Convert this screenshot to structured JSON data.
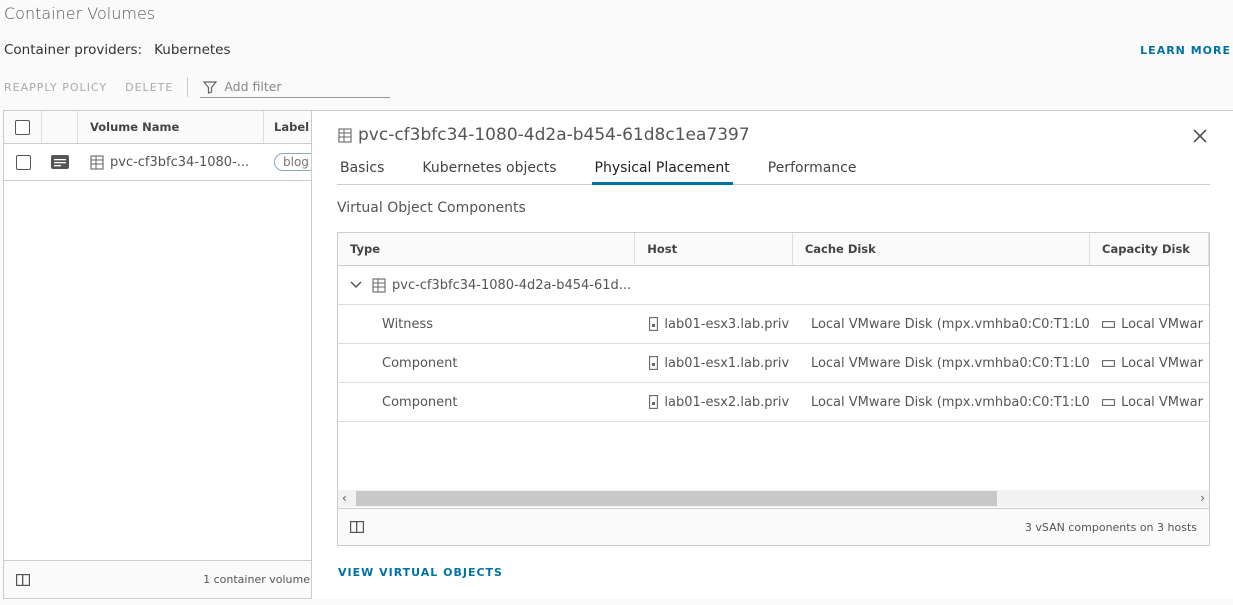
{
  "page": {
    "title": "Container Volumes"
  },
  "providers": {
    "label": "Container providers:",
    "value": "Kubernetes"
  },
  "learn_more": "LEARN MORE",
  "toolbar": {
    "reapply": "REAPPLY POLICY",
    "delete": "DELETE",
    "filter_placeholder": "Add filter"
  },
  "grid": {
    "columns": {
      "volume_name": "Volume Name",
      "label": "Label"
    },
    "rows": [
      {
        "name": "pvc-cf3bfc34-1080-...",
        "label": "blog"
      }
    ],
    "footer": "1 container volume"
  },
  "detail": {
    "title": "pvc-cf3bfc34-1080-4d2a-b454-61d8c1ea7397",
    "tabs": [
      "Basics",
      "Kubernetes objects",
      "Physical Placement",
      "Performance"
    ],
    "active_tab": "Physical Placement",
    "section_title": "Virtual Object Components",
    "table": {
      "columns": [
        "Type",
        "Host",
        "Cache Disk",
        "Capacity Disk"
      ],
      "parent": {
        "name": "pvc-cf3bfc34-1080-4d2a-b454-61d...",
        "extra": "("
      },
      "rows": [
        {
          "type": "Witness",
          "host": "lab01-esx3.lab.priv",
          "cache": "Local VMware Disk (mpx.vmhba0:C0:T1:L0)",
          "capacity": "Local VMwar"
        },
        {
          "type": "Component",
          "host": "lab01-esx1.lab.priv",
          "cache": "Local VMware Disk (mpx.vmhba0:C0:T1:L0)",
          "capacity": "Local VMwar"
        },
        {
          "type": "Component",
          "host": "lab01-esx2.lab.priv",
          "cache": "Local VMware Disk (mpx.vmhba0:C0:T1:L0)",
          "capacity": "Local VMwar"
        }
      ],
      "footer": "3 vSAN components on 3 hosts"
    },
    "view_virtual_objects": "VIEW VIRTUAL OBJECTS"
  },
  "icons": {
    "filter": "filter-icon",
    "close": "close-icon",
    "volume": "volume-icon",
    "host": "host-icon",
    "disk": "disk-icon",
    "columns": "column-toggle-icon",
    "detail": "detail-icon",
    "chevron": "chevron-down-icon"
  },
  "colors": {
    "accent": "#0072a3"
  }
}
